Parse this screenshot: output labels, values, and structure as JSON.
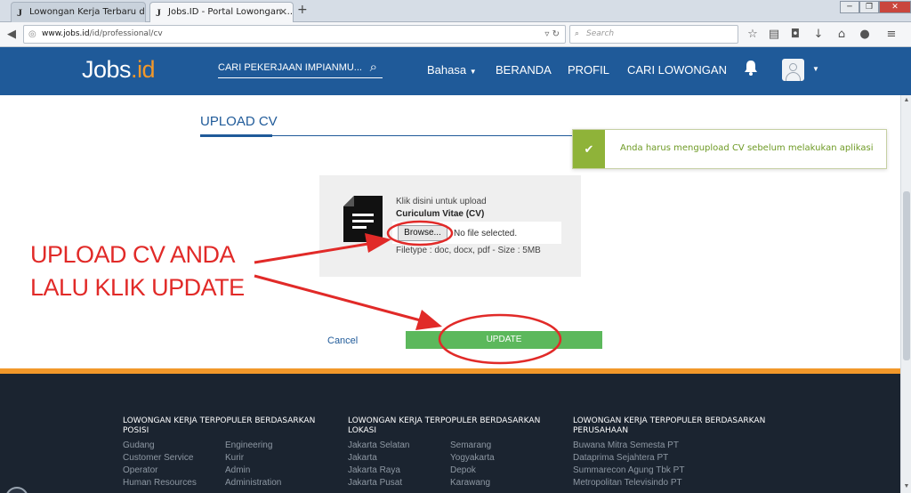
{
  "browser": {
    "tabs": [
      {
        "label": "Lowongan Kerja Terbaru di...",
        "favicon": "J",
        "active": false
      },
      {
        "label": "Jobs.ID - Portal Lowongan ...",
        "favicon": "J",
        "active": true
      }
    ],
    "new_tab": "+",
    "url_domain": "www.jobs.id",
    "url_path": "/id/professional/cv",
    "search_placeholder": "Search"
  },
  "header": {
    "logo_main": "Jobs",
    "logo_dot": ".",
    "logo_suffix": "id",
    "search_placeholder": "CARI PEKERJAAN IMPIANMU...",
    "nav": {
      "language": "Bahasa",
      "home": "BERANDA",
      "profile": "PROFIL",
      "search_jobs": "CARI LOWONGAN"
    }
  },
  "page": {
    "title": "UPLOAD CV",
    "toast_message": "Anda harus mengupload CV sebelum melakukan aplikasi",
    "upload": {
      "instruction": "Klik disini untuk upload",
      "doc_title": "Curiculum Vitae (CV)",
      "browse_label": "Browse...",
      "no_file": "No file selected.",
      "filetype": "Filetype : doc, docx, pdf - Size : 5MB"
    },
    "cancel_label": "Cancel",
    "update_label": "UPDATE"
  },
  "annotation": {
    "line1": "UPLOAD CV ANDA",
    "line2": "LALU KLIK UPDATE",
    "color": "#e12a28"
  },
  "footer": {
    "columns": [
      {
        "heading": "LOWONGAN KERJA TERPOPULER BERDASARKAN POSISI",
        "links_a": [
          "Gudang",
          "Customer Service",
          "Operator",
          "Human Resources"
        ],
        "links_b": [
          "Engineering",
          "Kurir",
          "Admin",
          "Administration"
        ]
      },
      {
        "heading": "LOWONGAN KERJA TERPOPULER BERDASARKAN LOKASI",
        "links_a": [
          "Jakarta Selatan",
          "Jakarta",
          "Jakarta Raya",
          "Jakarta Pusat"
        ],
        "links_b": [
          "Semarang",
          "Yogyakarta",
          "Depok",
          "Karawang"
        ]
      },
      {
        "heading": "LOWONGAN KERJA TERPOPULER BERDASARKAN PERUSAHAAN",
        "links_a": [
          "Buwana Mitra Semesta PT",
          "Dataprima Sejahtera PT",
          "Summarecon Agung Tbk PT",
          "Metropolitan Televisindo PT"
        ],
        "links_b": []
      }
    ]
  },
  "colors": {
    "brand_blue": "#1f5a99",
    "accent_orange": "#f2982a",
    "success_green": "#5cb85c",
    "footer_bg": "#1b2430"
  }
}
